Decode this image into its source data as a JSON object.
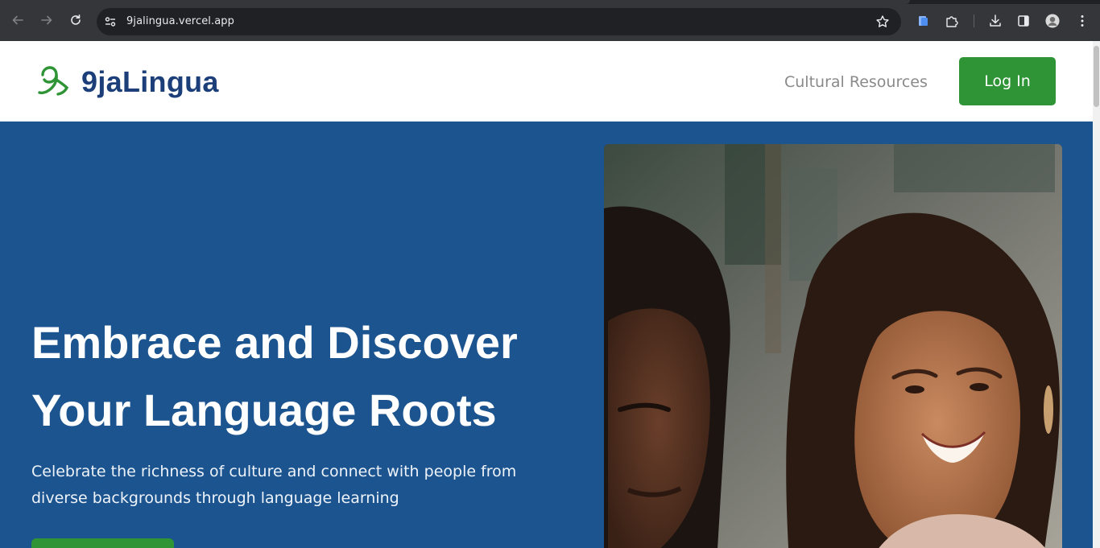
{
  "browser": {
    "url": "9jalingua.vercel.app",
    "icons": [
      "back-icon",
      "forward-icon",
      "reload-icon",
      "site-info-icon",
      "bookmark-star-icon",
      "extension-docs-icon",
      "extensions-puzzle-icon",
      "download-icon",
      "side-panel-icon",
      "profile-avatar",
      "menu-kebab-icon"
    ]
  },
  "header": {
    "brand": "9jaLingua",
    "nav_link": "Cultural Resources",
    "login_label": "Log In"
  },
  "hero": {
    "title": "Embrace and Discover Your Language Roots",
    "subtitle": "Celebrate the richness of culture and connect with people from diverse backgrounds through language learning"
  },
  "colors": {
    "brand_blue": "#1c3f7a",
    "hero_blue": "#1c548f",
    "accent_green": "#2e9436"
  }
}
